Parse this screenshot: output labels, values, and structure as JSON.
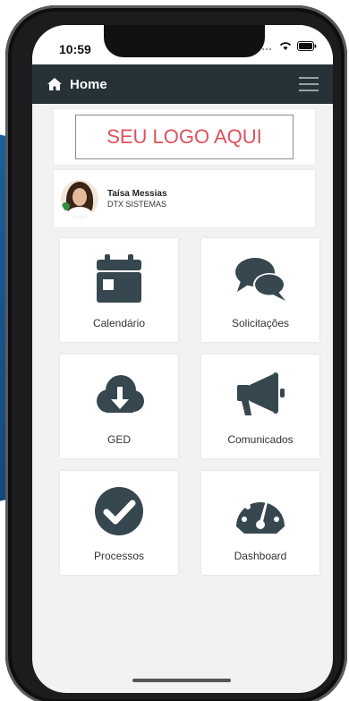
{
  "status_bar": {
    "time": "10:59"
  },
  "navbar": {
    "title": "Home"
  },
  "logo": {
    "text": "SEU LOGO AQUI"
  },
  "user": {
    "name": "Taísa Messias",
    "company": "DTX SISTEMAS"
  },
  "tiles": [
    {
      "label": "Calendário",
      "icon": "calendar-icon"
    },
    {
      "label": "Solicitações",
      "icon": "chat-bubbles-icon"
    },
    {
      "label": "GED",
      "icon": "cloud-download-icon"
    },
    {
      "label": "Comunicados",
      "icon": "megaphone-icon"
    },
    {
      "label": "Processos",
      "icon": "check-circle-icon"
    },
    {
      "label": "Dashboard",
      "icon": "gauge-icon"
    }
  ],
  "colors": {
    "navbar": "#263238",
    "icon": "#37474f",
    "logo_text": "#e0505b",
    "background": "#f2f2f2"
  }
}
